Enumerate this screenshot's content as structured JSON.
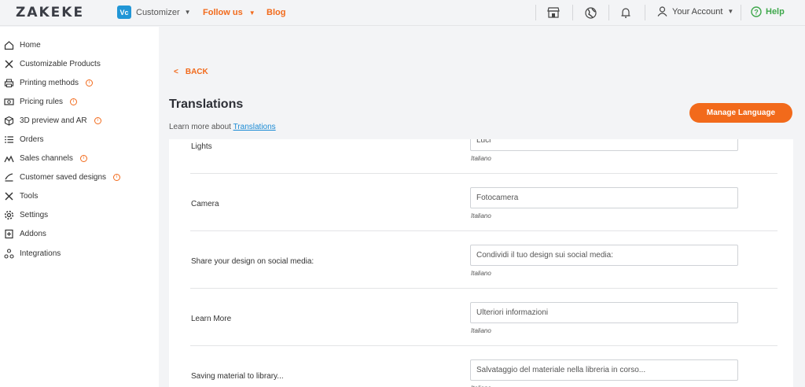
{
  "topbar": {
    "logo": "ZAKEKE",
    "product_badge": "Vc",
    "product_label": "Customizer",
    "follow_label": "Follow us",
    "blog_label": "Blog",
    "account_label": "Your Account",
    "help_label": "Help",
    "icons": [
      "store-icon",
      "globe-icon",
      "bell-icon",
      "user-icon",
      "help-circle-icon"
    ]
  },
  "sidebar": {
    "items": [
      {
        "label": "Home",
        "icon": "home-icon",
        "info": false
      },
      {
        "label": "Customizable Products",
        "icon": "tools-icon",
        "info": false
      },
      {
        "label": "Printing methods",
        "icon": "printer-icon",
        "info": true
      },
      {
        "label": "Pricing rules",
        "icon": "money-icon",
        "info": true
      },
      {
        "label": "3D preview and AR",
        "icon": "cube-icon",
        "info": true
      },
      {
        "label": "Orders",
        "icon": "list-icon",
        "info": false
      },
      {
        "label": "Sales channels",
        "icon": "channels-icon",
        "info": true
      },
      {
        "label": "Customer saved designs",
        "icon": "designs-icon",
        "info": true
      },
      {
        "label": "Tools",
        "icon": "tools-icon",
        "info": false
      },
      {
        "label": "Settings",
        "icon": "gear-icon",
        "info": false
      },
      {
        "label": "Addons",
        "icon": "addons-icon",
        "info": false
      },
      {
        "label": "Integrations",
        "icon": "integrations-icon",
        "info": false
      }
    ]
  },
  "main": {
    "back_label": "BACK",
    "title": "Translations",
    "learn_prefix": "Learn more about",
    "learn_link": "Translations",
    "manage_button": "Manage Language",
    "rows": [
      {
        "label": "Lights",
        "value": "Luci",
        "lang": "Italiano"
      },
      {
        "label": "Camera",
        "value": "Fotocamera",
        "lang": "Italiano"
      },
      {
        "label": "Share your design on social media:",
        "value": "Condividi il tuo design sui social media:",
        "lang": "Italiano"
      },
      {
        "label": "Learn More",
        "value": "Ulteriori informazioni",
        "lang": "Italiano"
      },
      {
        "label": "Saving material to library...",
        "value": "Salvataggio del materiale nella libreria in corso...",
        "lang": "Italiano"
      }
    ]
  },
  "colors": {
    "accent": "#f26a1b",
    "help": "#3fa84c",
    "link": "#1a8ad4",
    "badge": "#2196d6"
  }
}
